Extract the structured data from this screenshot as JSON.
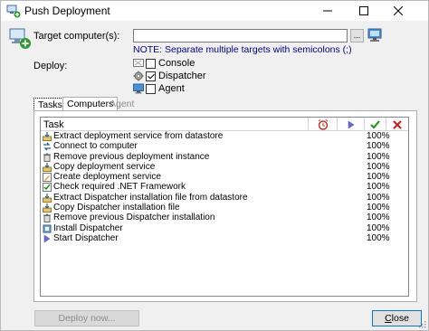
{
  "window": {
    "title": "Push Deployment",
    "icon": "push-deployment-icon",
    "controls": {
      "minimize": "—",
      "maximize": "☐",
      "close": "✕"
    }
  },
  "target": {
    "label": "Target computer(s):",
    "value": "",
    "browse_label": "...",
    "note": "NOTE: Separate multiple targets with semicolons (;)"
  },
  "deploy": {
    "label": "Deploy:",
    "options": [
      {
        "label": "Console",
        "checked": false,
        "icon": "console-icon"
      },
      {
        "label": "Dispatcher",
        "checked": true,
        "icon": "gear-icon"
      },
      {
        "label": "Agent",
        "checked": false,
        "icon": "monitor-icon"
      }
    ]
  },
  "tabs": [
    {
      "label": "Tasks",
      "state": "focused"
    },
    {
      "label": "Computers",
      "state": "selected"
    },
    {
      "label": "Agent settings",
      "state": "disabled"
    }
  ],
  "grid": {
    "columns": [
      "Task",
      "alarm-clock-icon",
      "play-icon",
      "check-icon",
      "x-icon"
    ],
    "rows": [
      {
        "icon": "download-icon",
        "task": "Extract deployment service from datastore",
        "progress": "100%"
      },
      {
        "icon": "connect-icon",
        "task": "Connect to computer",
        "progress": "100%"
      },
      {
        "icon": "trash-icon",
        "task": "Remove previous deployment instance",
        "progress": "100%"
      },
      {
        "icon": "copy-icon",
        "task": "Copy deployment service",
        "progress": "100%"
      },
      {
        "icon": "create-icon",
        "task": "Create deployment service",
        "progress": "100%"
      },
      {
        "icon": "check-icon",
        "task": "Check required .NET Framework",
        "progress": "100%"
      },
      {
        "icon": "download-icon",
        "task": "Extract Dispatcher installation file from datastore",
        "progress": "100%"
      },
      {
        "icon": "copy-icon",
        "task": "Copy Dispatcher installation file",
        "progress": "100%"
      },
      {
        "icon": "trash-icon",
        "task": "Remove previous Dispatcher installation",
        "progress": "100%"
      },
      {
        "icon": "install-icon",
        "task": "Install Dispatcher",
        "progress": "100%"
      },
      {
        "icon": "play-icon",
        "task": "Start Dispatcher",
        "progress": "100%"
      }
    ]
  },
  "buttons": {
    "deploy": "Deploy now...",
    "close_first": "C",
    "close_rest": "lose"
  },
  "colors": {
    "note": "#000080",
    "accent": "#0078d7",
    "check": "#1a8f1a",
    "x": "#d11a1a"
  }
}
